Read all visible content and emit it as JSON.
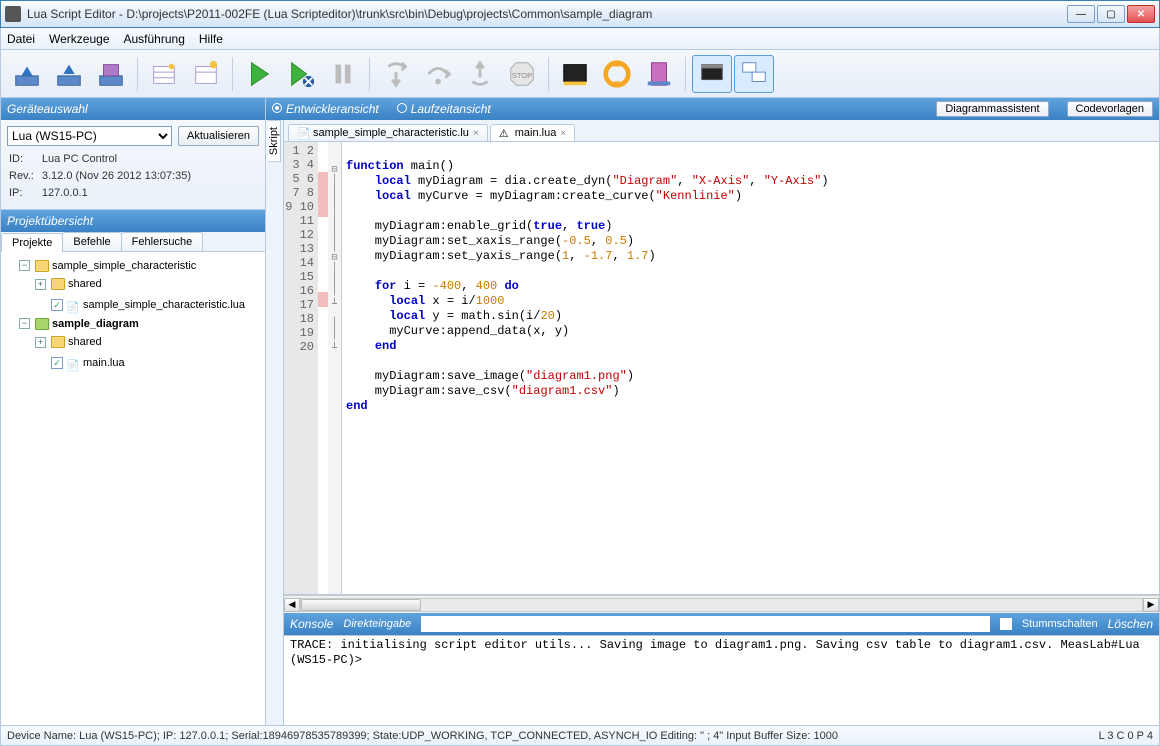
{
  "window": {
    "title": "Lua Script Editor - D:\\projects\\P2011-002FE (Lua Scripteditor)\\trunk\\src\\bin\\Debug\\projects\\Common\\sample_diagram"
  },
  "menu": {
    "items": [
      "Datei",
      "Werkzeuge",
      "Ausführung",
      "Hilfe"
    ]
  },
  "left": {
    "device_panel": {
      "title": "Geräteauswahl",
      "select_value": "Lua (WS15-PC)",
      "refresh_btn": "Aktualisieren",
      "id_label": "ID:",
      "id_value": "Lua PC Control",
      "rev_label": "Rev.:",
      "rev_value": "3.12.0 (Nov 26 2012 13:07:35)",
      "ip_label": "IP:",
      "ip_value": "127.0.0.1"
    },
    "project_panel": {
      "title": "Projektübersicht",
      "tabs": [
        "Projekte",
        "Befehle",
        "Fehlersuche"
      ],
      "tree": {
        "p1": "sample_simple_characteristic",
        "p1_shared": "shared",
        "p1_file": "sample_simple_characteristic.lua",
        "p2": "sample_diagram",
        "p2_shared": "shared",
        "p2_file": "main.lua"
      }
    }
  },
  "viewbar": {
    "opt1": "Entwickleransicht",
    "opt2": "Laufzeitansicht",
    "btn1": "Diagrammassistent",
    "btn2": "Codevorlagen"
  },
  "skript_tab": "Skript",
  "filetabs": {
    "t1": "sample_simple_characteristic.lu",
    "t2": "main.lua"
  },
  "code": {
    "lines": [
      1,
      2,
      3,
      4,
      5,
      6,
      7,
      8,
      9,
      10,
      11,
      12,
      13,
      14,
      15,
      16,
      17,
      18,
      19,
      20
    ]
  },
  "console": {
    "title": "Konsole",
    "direct": "Direkteingabe",
    "mute": "Stummschalten",
    "clear": "Löschen",
    "lines": [
      "TRACE: initialising script editor utils...",
      "Saving image to diagram1.png.",
      "Saving csv table to diagram1.csv.",
      "MeasLab#Lua (WS15-PC)>"
    ]
  },
  "status": {
    "left": "Device Name: Lua (WS15-PC); IP: 127.0.0.1; Serial:18946978535789399; State:UDP_WORKING, TCP_CONNECTED, ASYNCH_IO  Editing: \" ; 4\"   Input Buffer Size: 1000",
    "right": "L 3  C 0  P 4"
  }
}
